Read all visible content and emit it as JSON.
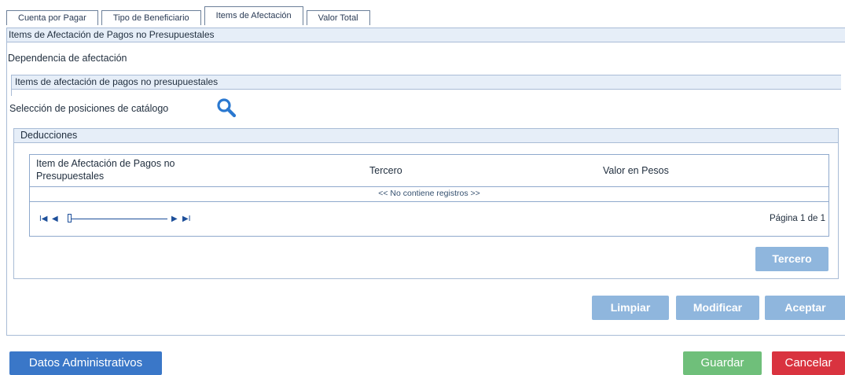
{
  "tabs": [
    {
      "label": "Cuenta por Pagar"
    },
    {
      "label": "Tipo de Beneficiario"
    },
    {
      "label": "Items de Afectación"
    },
    {
      "label": "Valor Total"
    }
  ],
  "panel": {
    "title": "Items de Afectación de Pagos no Presupuestales",
    "dependencia_label": "Dependencia de afectación",
    "items_panel_title": "Items de afectación de pagos no presupuestales",
    "seleccion_label": "Selección de posiciones de catálogo"
  },
  "deducciones": {
    "title": "Deducciones",
    "columns": [
      "Item de Afectación de Pagos no Presupuestales",
      "Tercero",
      "Valor en Pesos"
    ],
    "empty_text": "<< No contiene registros >>",
    "pager": {
      "first": "I◀◀",
      "prev": "◀",
      "next": "▶",
      "last": "▶▶I",
      "page_info": "Página 1 de 1",
      "position": 0
    },
    "tercero_button": "Tercero"
  },
  "actions": {
    "limpiar": "Limpiar",
    "modificar": "Modificar",
    "aceptar": "Aceptar"
  },
  "footer": {
    "datos_administrativos": "Datos Administrativos",
    "guardar": "Guardar",
    "cancelar": "Cancelar"
  },
  "colors": {
    "accent": "#3a77c8",
    "header_bg": "#e6eef8",
    "border": "#a9bcd6",
    "button_light": "#8fb6dd",
    "save": "#6fbf7a",
    "cancel": "#d9333f"
  },
  "icons": {
    "search": "search-icon"
  }
}
